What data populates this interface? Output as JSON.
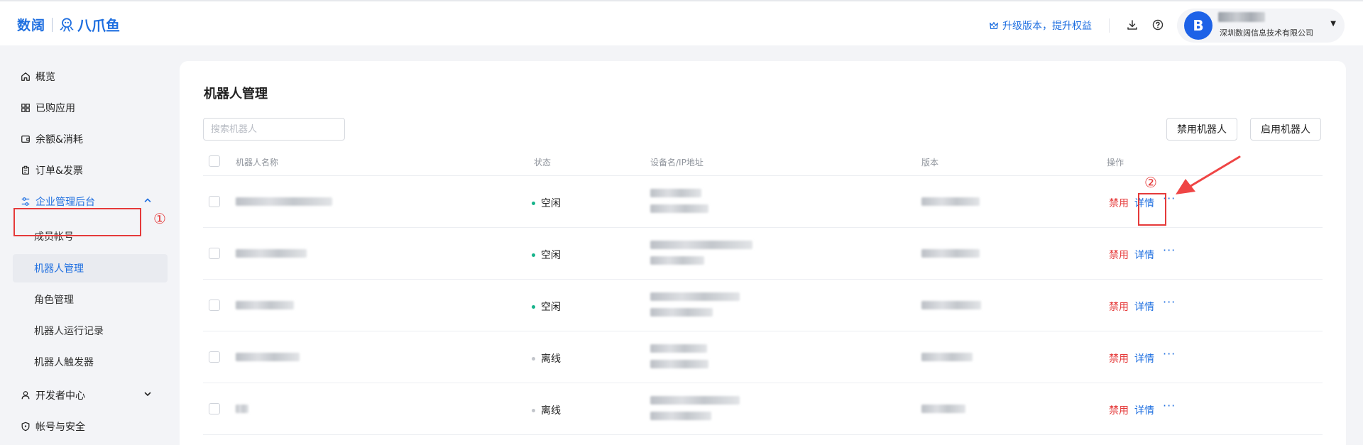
{
  "header": {
    "logo_text_1": "数阔",
    "logo_text_2": "八爪鱼",
    "upgrade_label": "升级版本，提升权益",
    "user_avatar_letter": "B",
    "user_company": "深圳数阔信息技术有限公司"
  },
  "sidebar": {
    "items": [
      {
        "label": "概览"
      },
      {
        "label": "已购应用"
      },
      {
        "label": "余额&消耗"
      },
      {
        "label": "订单&发票"
      },
      {
        "label": "企业管理后台"
      },
      {
        "label": "开发者中心"
      },
      {
        "label": "帐号与安全"
      }
    ],
    "sub_items": [
      {
        "label": "成员帐号"
      },
      {
        "label": "机器人管理"
      },
      {
        "label": "角色管理"
      },
      {
        "label": "机器人运行记录"
      },
      {
        "label": "机器人触发器"
      }
    ]
  },
  "main": {
    "title": "机器人管理",
    "search_placeholder": "搜索机器人",
    "disable_robot_button": "禁用机器人",
    "enable_robot_button": "启用机器人",
    "table": {
      "columns": [
        "机器人名称",
        "状态",
        "设备名/IP地址",
        "版本",
        "操作"
      ],
      "rows": [
        {
          "status": "空闲"
        },
        {
          "status": "空闲"
        },
        {
          "status": "空闲"
        },
        {
          "status": "离线"
        },
        {
          "status": "离线"
        }
      ],
      "action_disable": "禁用",
      "action_detail": "详情",
      "action_more": "···"
    }
  },
  "annotations": {
    "marker_1": "①",
    "marker_2": "②"
  },
  "colors": {
    "accent": "#1f6fe0",
    "danger": "#e53a3a",
    "idle_dot": "#16b38a",
    "offline_dot": "#c2c5cb"
  }
}
